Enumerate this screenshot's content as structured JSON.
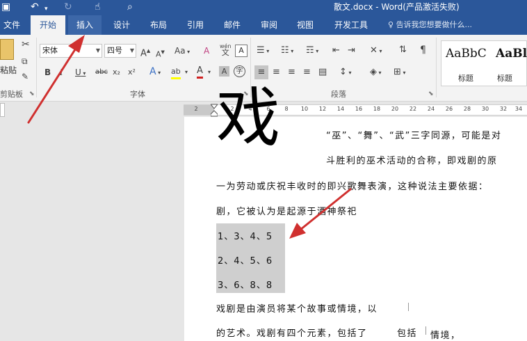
{
  "titlebar": {
    "title": "散文.docx - Word(产品激活失败)",
    "save_icon": "save-icon",
    "undo_icon": "undo-icon",
    "redo_icon": "redo-icon",
    "touch_icon": "touch-mode-icon",
    "preview_icon": "print-preview-icon"
  },
  "tabs": [
    {
      "label": "文件"
    },
    {
      "label": "开始"
    },
    {
      "label": "插入"
    },
    {
      "label": "设计"
    },
    {
      "label": "布局"
    },
    {
      "label": "引用"
    },
    {
      "label": "邮件"
    },
    {
      "label": "审阅"
    },
    {
      "label": "视图"
    },
    {
      "label": "开发工具"
    }
  ],
  "tell_me": "告诉我您想要做什么...",
  "clipboard": {
    "paste_label": "粘贴",
    "group_label": "剪贴板"
  },
  "font": {
    "name": "宋体",
    "size": "四号",
    "group_label": "字体",
    "grow": "A",
    "shrink": "A",
    "case": "Aa",
    "clear_format": "A",
    "phonetic_top": "wén",
    "phonetic_bottom": "文",
    "border_char": "A",
    "bold": "B",
    "italic": "I",
    "underline": "U",
    "strike": "abc",
    "subscript": "x₂",
    "superscript": "x²",
    "text_effects": "A",
    "highlight": "ab",
    "font_color": "A",
    "shading": "A",
    "enclose": "字"
  },
  "paragraph": {
    "group_label": "段落"
  },
  "styles": {
    "sample1": "AaBbC",
    "name1": "标题",
    "sample2": "AaBl",
    "name2": "标题"
  },
  "ruler": {
    "ticks": [
      "2",
      "2",
      "4",
      "6",
      "8",
      "10",
      "12",
      "14",
      "16",
      "18",
      "20",
      "22",
      "24",
      "26",
      "28",
      "30",
      "32",
      "34"
    ]
  },
  "document": {
    "big_char": "戏",
    "line1": "“巫”、“舞”、“武”三字同源，可能是对",
    "line2": "斗胜利的巫术活动的合称，即戏剧的原",
    "line3": "一为劳动或庆祝丰收时的即兴歌舞表演，这种说法主要依据：",
    "line4": "剧，它被认为是起源于酒神祭祀",
    "list": [
      "1、3、4、5",
      "2、4、5、6",
      "3、6、8、8"
    ],
    "line5": "戏剧是由演员将某个故事或情境，以",
    "line6": "的艺术。戏剧有四个元素，包括了",
    "line6b": "包括",
    "line6c": "情境，"
  },
  "colors": {
    "accent": "#2b579a",
    "arrow": "#d0302f",
    "selection": "#cfcfcf"
  }
}
